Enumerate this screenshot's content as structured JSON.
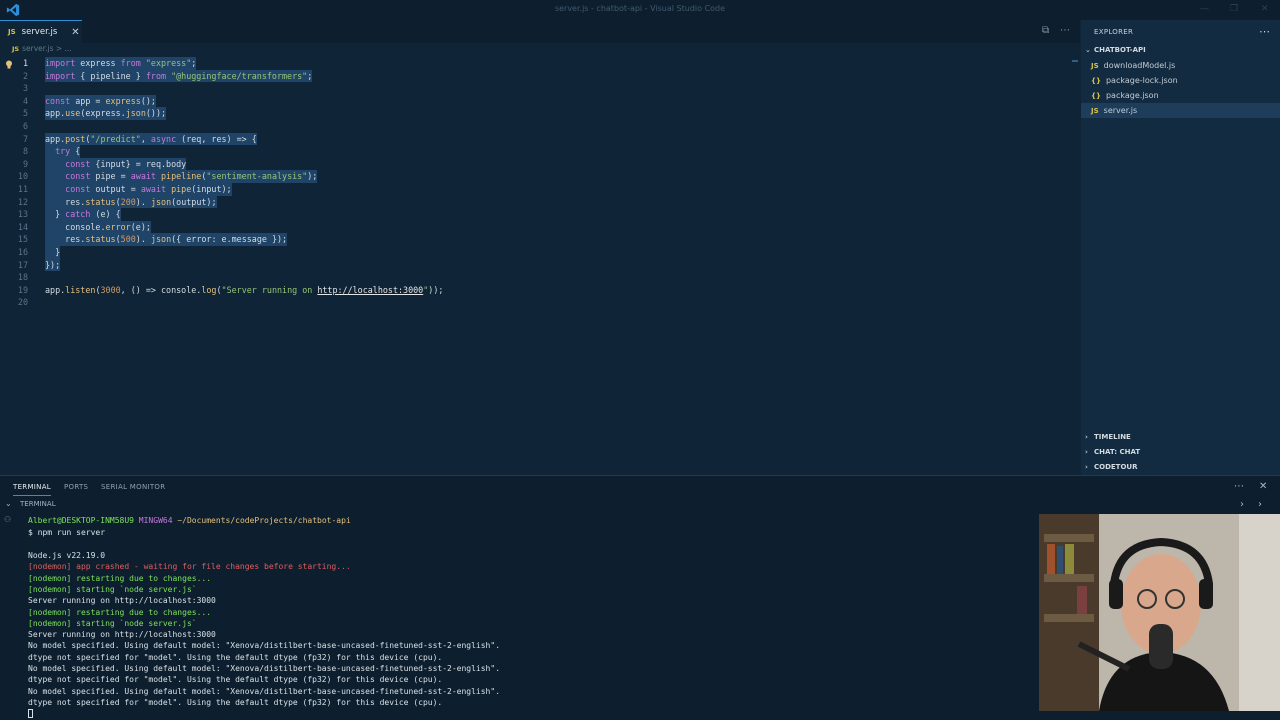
{
  "window": {
    "title": "server.js - chatbot-api - Visual Studio Code"
  },
  "editor": {
    "tab_label": "server.js",
    "tab_badge": "JS",
    "breadcrumb": "server.js > ..."
  },
  "code_lines": [
    {
      "n": "1",
      "parts": [
        [
          "kw",
          "import"
        ],
        [
          "",
          " express "
        ],
        [
          "kw",
          "from"
        ],
        [
          "",
          " "
        ],
        [
          "str",
          "\"express\""
        ],
        [
          "",
          ";"
        ]
      ]
    },
    {
      "n": "2",
      "parts": [
        [
          "kw",
          "import"
        ],
        [
          "",
          " { pipeline } "
        ],
        [
          "kw",
          "from"
        ],
        [
          "",
          " "
        ],
        [
          "str",
          "\"@huggingface/transformers\""
        ],
        [
          "",
          ";"
        ]
      ]
    },
    {
      "n": "3",
      "parts": []
    },
    {
      "n": "4",
      "parts": [
        [
          "kw",
          "const"
        ],
        [
          "",
          " app = "
        ],
        [
          "fn",
          "express"
        ],
        [
          "",
          "();"
        ]
      ]
    },
    {
      "n": "5",
      "parts": [
        [
          "",
          "app."
        ],
        [
          "fn",
          "use"
        ],
        [
          "",
          "(express."
        ],
        [
          "fn",
          "json"
        ],
        [
          "",
          "());"
        ]
      ]
    },
    {
      "n": "6",
      "parts": []
    },
    {
      "n": "7",
      "parts": [
        [
          "",
          "app."
        ],
        [
          "fn",
          "post"
        ],
        [
          "",
          "("
        ],
        [
          "str",
          "\"/predict\""
        ],
        [
          "",
          ", "
        ],
        [
          "kw",
          "async"
        ],
        [
          "",
          " (req, res) => {"
        ]
      ]
    },
    {
      "n": "8",
      "parts": [
        [
          "",
          "  "
        ],
        [
          "kw",
          "try"
        ],
        [
          "",
          " {"
        ]
      ]
    },
    {
      "n": "9",
      "parts": [
        [
          "",
          "    "
        ],
        [
          "kw",
          "const"
        ],
        [
          "",
          " {input} = req.body"
        ]
      ]
    },
    {
      "n": "10",
      "parts": [
        [
          "",
          "    "
        ],
        [
          "kw",
          "const"
        ],
        [
          "",
          " pipe = "
        ],
        [
          "kw",
          "await"
        ],
        [
          "",
          " "
        ],
        [
          "fn",
          "pipeline"
        ],
        [
          "",
          "("
        ],
        [
          "str",
          "\"sentiment-analysis\""
        ],
        [
          "",
          ");"
        ]
      ]
    },
    {
      "n": "11",
      "parts": [
        [
          "",
          "    "
        ],
        [
          "kw",
          "const"
        ],
        [
          "",
          " output = "
        ],
        [
          "kw",
          "await"
        ],
        [
          "",
          " "
        ],
        [
          "fn",
          "pipe"
        ],
        [
          "",
          "(input);"
        ]
      ]
    },
    {
      "n": "12",
      "parts": [
        [
          "",
          "    res."
        ],
        [
          "fn",
          "status"
        ],
        [
          "",
          "("
        ],
        [
          "num",
          "200"
        ],
        [
          "",
          "). "
        ],
        [
          "fn",
          "json"
        ],
        [
          "",
          "(output);"
        ]
      ]
    },
    {
      "n": "13",
      "parts": [
        [
          "",
          "  } "
        ],
        [
          "kw",
          "catch"
        ],
        [
          "",
          " (e) {"
        ]
      ]
    },
    {
      "n": "14",
      "parts": [
        [
          "",
          "    console."
        ],
        [
          "fn",
          "error"
        ],
        [
          "",
          "(e);"
        ]
      ]
    },
    {
      "n": "15",
      "parts": [
        [
          "",
          "    res."
        ],
        [
          "fn",
          "status"
        ],
        [
          "",
          "("
        ],
        [
          "num",
          "500"
        ],
        [
          "",
          "). "
        ],
        [
          "fn",
          "json"
        ],
        [
          "",
          "({ error: e.message });"
        ]
      ]
    },
    {
      "n": "16",
      "parts": [
        [
          "",
          "  }"
        ]
      ]
    },
    {
      "n": "17",
      "parts": [
        [
          "",
          "});"
        ]
      ]
    },
    {
      "n": "18",
      "parts": []
    },
    {
      "n": "19",
      "parts": [
        [
          "",
          "app."
        ],
        [
          "fn",
          "listen"
        ],
        [
          "",
          "("
        ],
        [
          "num",
          "3000"
        ],
        [
          "",
          ", () => console."
        ],
        [
          "fn",
          "log"
        ],
        [
          "",
          "("
        ],
        [
          "str",
          "\"Server running on "
        ],
        [
          "url",
          "http://localhost:3000"
        ],
        [
          "str",
          "\""
        ],
        [
          "",
          "));"
        ]
      ]
    },
    {
      "n": "20",
      "parts": []
    }
  ],
  "sidebar": {
    "title": "EXPLORER",
    "folder": "CHATBOT-API",
    "files": [
      {
        "badge": "JS",
        "name": "downloadModel.js",
        "active": false
      },
      {
        "badge": "{}",
        "name": "package-lock.json",
        "active": false
      },
      {
        "badge": "{}",
        "name": "package.json",
        "active": false
      },
      {
        "badge": "JS",
        "name": "server.js",
        "active": true
      }
    ],
    "sections": [
      "TIMELINE",
      "CHAT: CHAT",
      "CODETOUR"
    ]
  },
  "panel": {
    "tabs": [
      "TERMINAL",
      "PORTS",
      "SERIAL MONITOR"
    ],
    "terminal_title": "TERMINAL"
  },
  "terminal": {
    "prompt_user": "Albert@DESKTOP-INM58U9",
    "prompt_host": "MINGW64",
    "prompt_path": "~/Documents/codeProjects/chatbot-api",
    "command": "$ npm run server",
    "lines": [
      {
        "cls": "",
        "text": "Node.js v22.19.0"
      },
      {
        "cls": "t-red",
        "text": "[nodemon] app crashed - waiting for file changes before starting..."
      },
      {
        "cls": "t-green",
        "text": "[nodemon] restarting due to changes..."
      },
      {
        "cls": "t-green",
        "text": "[nodemon] starting `node server.js`"
      },
      {
        "cls": "",
        "text": "Server running on http://localhost:3000"
      },
      {
        "cls": "t-green",
        "text": "[nodemon] restarting due to changes..."
      },
      {
        "cls": "t-green",
        "text": "[nodemon] starting `node server.js`"
      },
      {
        "cls": "",
        "text": "Server running on http://localhost:3000"
      },
      {
        "cls": "",
        "text": "No model specified. Using default model: \"Xenova/distilbert-base-uncased-finetuned-sst-2-english\"."
      },
      {
        "cls": "",
        "text": "dtype not specified for \"model\". Using the default dtype (fp32) for this device (cpu)."
      },
      {
        "cls": "",
        "text": "No model specified. Using default model: \"Xenova/distilbert-base-uncased-finetuned-sst-2-english\"."
      },
      {
        "cls": "",
        "text": "dtype not specified for \"model\". Using the default dtype (fp32) for this device (cpu)."
      },
      {
        "cls": "",
        "text": "No model specified. Using default model: \"Xenova/distilbert-base-uncased-finetuned-sst-2-english\"."
      },
      {
        "cls": "",
        "text": "dtype not specified for \"model\". Using the default dtype (fp32) for this device (cpu)."
      }
    ]
  },
  "colors": {
    "accent": "#2f8fd6",
    "editor_bg": "#0f2436",
    "selection": "#264f78"
  }
}
